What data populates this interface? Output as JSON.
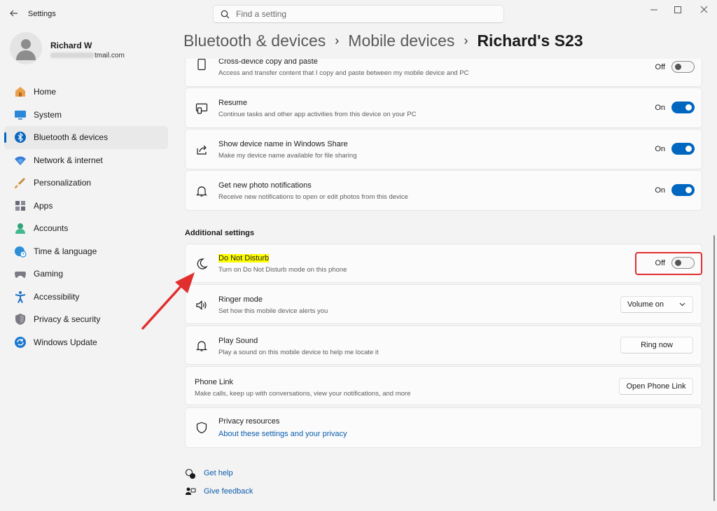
{
  "window": {
    "title": "Settings"
  },
  "search": {
    "placeholder": "Find a setting"
  },
  "profile": {
    "name": "Richard W",
    "email_suffix": "tmail.com"
  },
  "sidebar": {
    "items": [
      {
        "label": "Home",
        "icon": "home-icon"
      },
      {
        "label": "System",
        "icon": "system-icon"
      },
      {
        "label": "Bluetooth & devices",
        "icon": "bluetooth-icon",
        "active": true
      },
      {
        "label": "Network & internet",
        "icon": "wifi-icon"
      },
      {
        "label": "Personalization",
        "icon": "brush-icon"
      },
      {
        "label": "Apps",
        "icon": "apps-icon"
      },
      {
        "label": "Accounts",
        "icon": "accounts-icon"
      },
      {
        "label": "Time & language",
        "icon": "globe-clock-icon"
      },
      {
        "label": "Gaming",
        "icon": "gamepad-icon"
      },
      {
        "label": "Accessibility",
        "icon": "accessibility-icon"
      },
      {
        "label": "Privacy & security",
        "icon": "shield-icon"
      },
      {
        "label": "Windows Update",
        "icon": "update-icon"
      }
    ]
  },
  "breadcrumb": {
    "level1": "Bluetooth & devices",
    "level2": "Mobile devices",
    "current": "Richard's S23",
    "separator": "›"
  },
  "settings": {
    "copy_paste": {
      "title": "Cross-device copy and paste",
      "subtitle": "Access and transfer content that I copy and paste between my mobile device and PC",
      "state": "Off"
    },
    "resume": {
      "title": "Resume",
      "subtitle": "Continue tasks and other app activities from this device on your PC",
      "state": "On"
    },
    "device_name": {
      "title": "Show device name in Windows Share",
      "subtitle": "Make my device name available for file sharing",
      "state": "On"
    },
    "photo_notifications": {
      "title": "Get new photo notifications",
      "subtitle": "Receive new notifications to open or edit photos from this device",
      "state": "On"
    }
  },
  "additional": {
    "heading": "Additional settings",
    "dnd": {
      "title": "Do Not Disturb",
      "subtitle": "Turn on Do Not Disturb mode on this phone",
      "state": "Off"
    },
    "ringer": {
      "title": "Ringer mode",
      "subtitle": "Set how this mobile device alerts you",
      "value": "Volume on"
    },
    "play_sound": {
      "title": "Play Sound",
      "subtitle": "Play a sound on this mobile device to help me locate it",
      "button": "Ring now"
    },
    "phone_link": {
      "title": "Phone Link",
      "subtitle": "Make calls, keep up with conversations, view your notifications, and more",
      "button": "Open Phone Link"
    },
    "privacy": {
      "title": "Privacy resources",
      "link": "About these settings and your privacy"
    }
  },
  "help": {
    "get_help": "Get help",
    "give_feedback": "Give feedback"
  },
  "colors": {
    "accent": "#0067c0",
    "annotation": "#e12f2f",
    "highlight": "#ffff00"
  }
}
